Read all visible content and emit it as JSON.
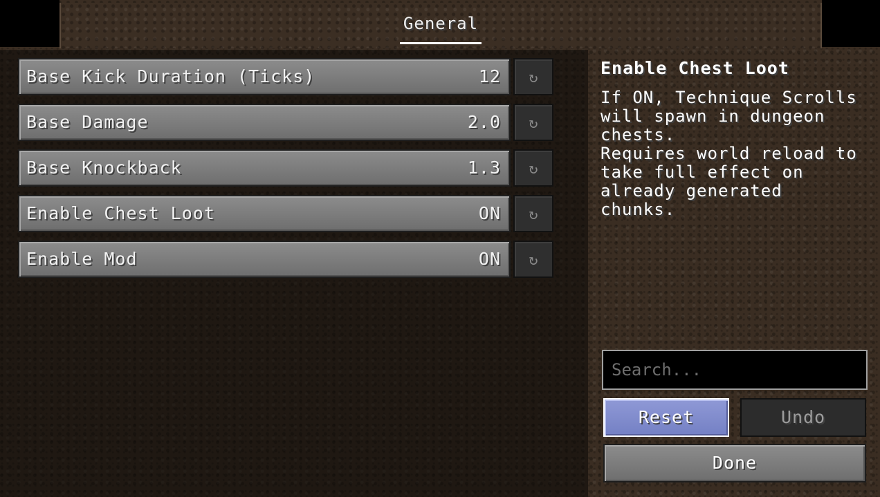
{
  "tabs": [
    {
      "label": "General",
      "active": true
    }
  ],
  "options": [
    {
      "label": "Base Kick Duration (Ticks)",
      "value": "12"
    },
    {
      "label": "Base Damage",
      "value": "2.0"
    },
    {
      "label": "Base Knockback",
      "value": "1.3"
    },
    {
      "label": "Enable Chest Loot",
      "value": "ON"
    },
    {
      "label": "Enable Mod",
      "value": "ON"
    }
  ],
  "reset_glyph": "↻",
  "description": {
    "title": "Enable Chest Loot",
    "body": "If ON, Technique Scrolls\nwill spawn in dungeon\nchests.\nRequires world reload to\ntake full effect on\nalready generated\nchunks."
  },
  "search": {
    "placeholder": "Search...",
    "value": ""
  },
  "buttons": {
    "reset": "Reset",
    "undo": "Undo",
    "done": "Done"
  },
  "colors": {
    "accent_reset": "#7f8ad0",
    "panel_bg": "#3a2d22"
  }
}
